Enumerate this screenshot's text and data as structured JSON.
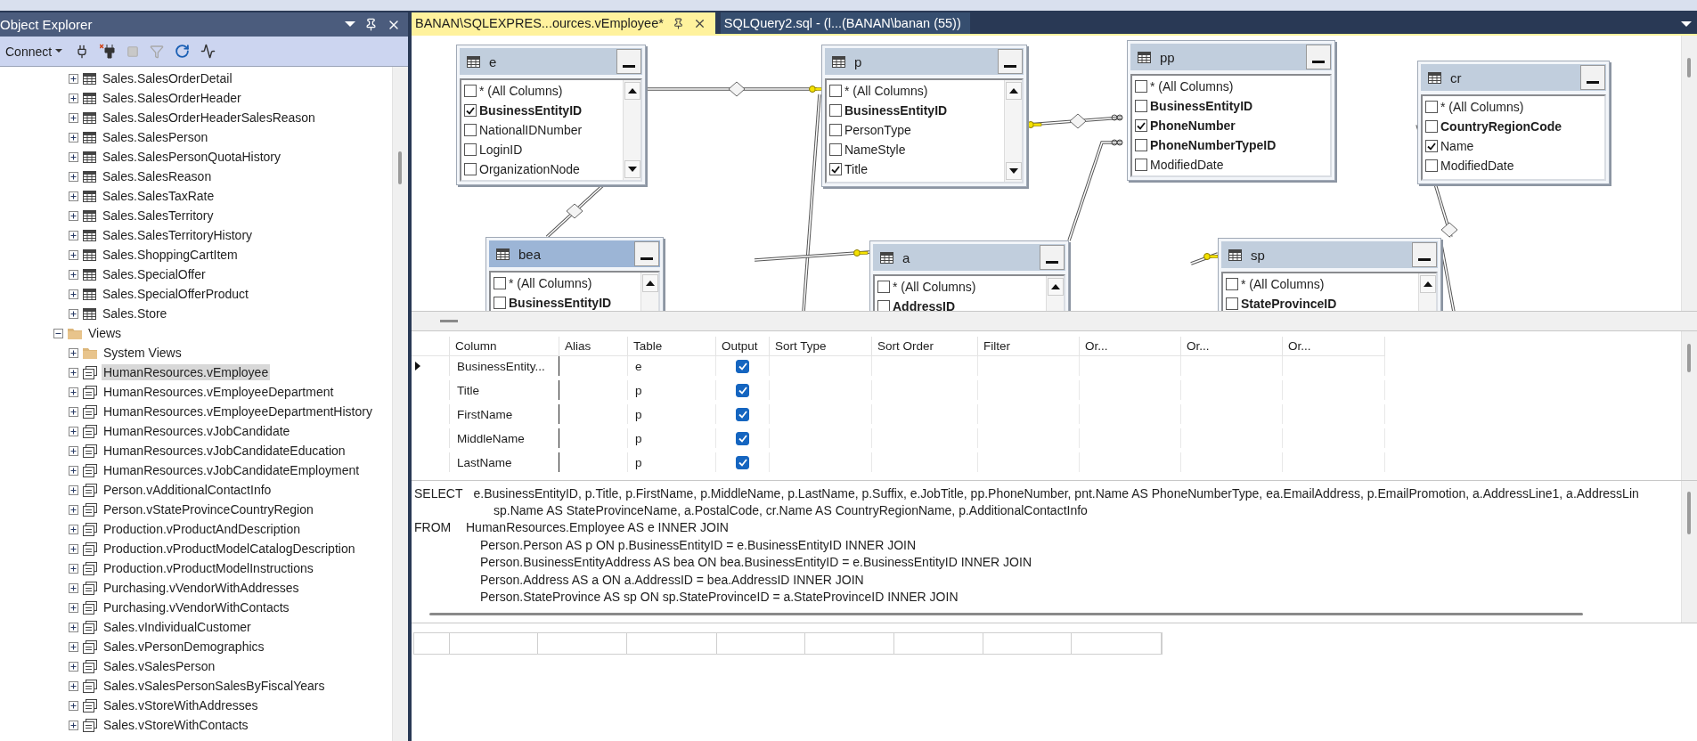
{
  "object_explorer": {
    "title": "Object Explorer",
    "toolbar": {
      "connect": "Connect"
    },
    "tree": [
      {
        "kind": "group",
        "children": [
          {
            "label": "Sales.SalesOrderDetail",
            "kind": "table",
            "expanded": false,
            "selected": false
          },
          {
            "label": "Sales.SalesOrderHeader",
            "kind": "table",
            "expanded": false,
            "selected": false
          },
          {
            "label": "Sales.SalesOrderHeaderSalesReason",
            "kind": "table",
            "expanded": false,
            "selected": false
          },
          {
            "label": "Sales.SalesPerson",
            "kind": "table",
            "expanded": false,
            "selected": false
          },
          {
            "label": "Sales.SalesPersonQuotaHistory",
            "kind": "table",
            "expanded": false,
            "selected": false
          },
          {
            "label": "Sales.SalesReason",
            "kind": "table",
            "expanded": false,
            "selected": false
          },
          {
            "label": "Sales.SalesTaxRate",
            "kind": "table",
            "expanded": false,
            "selected": false
          },
          {
            "label": "Sales.SalesTerritory",
            "kind": "table",
            "expanded": false,
            "selected": false
          },
          {
            "label": "Sales.SalesTerritoryHistory",
            "kind": "table",
            "expanded": false,
            "selected": false
          },
          {
            "label": "Sales.ShoppingCartItem",
            "kind": "table",
            "expanded": false,
            "selected": false
          },
          {
            "label": "Sales.SpecialOffer",
            "kind": "table",
            "expanded": false,
            "selected": false
          },
          {
            "label": "Sales.SpecialOfferProduct",
            "kind": "table",
            "expanded": false,
            "selected": false
          },
          {
            "label": "Sales.Store",
            "kind": "table",
            "expanded": false,
            "selected": false
          }
        ]
      },
      {
        "label": "Views",
        "kind": "folder",
        "expanded": true,
        "selected": false,
        "children": [
          {
            "label": "System Views",
            "kind": "folder",
            "expanded": false,
            "selected": false
          },
          {
            "label": "HumanResources.vEmployee",
            "kind": "view",
            "expanded": false,
            "selected": true
          },
          {
            "label": "HumanResources.vEmployeeDepartment",
            "kind": "view",
            "expanded": false,
            "selected": false
          },
          {
            "label": "HumanResources.vEmployeeDepartmentHistory",
            "kind": "view",
            "expanded": false,
            "selected": false
          },
          {
            "label": "HumanResources.vJobCandidate",
            "kind": "view",
            "expanded": false,
            "selected": false
          },
          {
            "label": "HumanResources.vJobCandidateEducation",
            "kind": "view",
            "expanded": false,
            "selected": false
          },
          {
            "label": "HumanResources.vJobCandidateEmployment",
            "kind": "view",
            "expanded": false,
            "selected": false
          },
          {
            "label": "Person.vAdditionalContactInfo",
            "kind": "view",
            "expanded": false,
            "selected": false
          },
          {
            "label": "Person.vStateProvinceCountryRegion",
            "kind": "view",
            "expanded": false,
            "selected": false
          },
          {
            "label": "Production.vProductAndDescription",
            "kind": "view",
            "expanded": false,
            "selected": false
          },
          {
            "label": "Production.vProductModelCatalogDescription",
            "kind": "view",
            "expanded": false,
            "selected": false
          },
          {
            "label": "Production.vProductModelInstructions",
            "kind": "view",
            "expanded": false,
            "selected": false
          },
          {
            "label": "Purchasing.vVendorWithAddresses",
            "kind": "view",
            "expanded": false,
            "selected": false
          },
          {
            "label": "Purchasing.vVendorWithContacts",
            "kind": "view",
            "expanded": false,
            "selected": false
          },
          {
            "label": "Sales.vIndividualCustomer",
            "kind": "view",
            "expanded": false,
            "selected": false
          },
          {
            "label": "Sales.vPersonDemographics",
            "kind": "view",
            "expanded": false,
            "selected": false
          },
          {
            "label": "Sales.vSalesPerson",
            "kind": "view",
            "expanded": false,
            "selected": false
          },
          {
            "label": "Sales.vSalesPersonSalesByFiscalYears",
            "kind": "view",
            "expanded": false,
            "selected": false
          },
          {
            "label": "Sales.vStoreWithAddresses",
            "kind": "view",
            "expanded": false,
            "selected": false
          },
          {
            "label": "Sales.vStoreWithContacts",
            "kind": "view",
            "expanded": false,
            "selected": false
          }
        ]
      }
    ]
  },
  "tabs": [
    {
      "label": "BANAN\\SQLEXPRES...ources.vEmployee*",
      "selected": true
    },
    {
      "label": "SQLQuery2.sql - (l...(BANAN\\banan (55))",
      "selected": false
    }
  ],
  "diagram": {
    "tables": [
      {
        "alias": "e",
        "selected": false,
        "scrollable": true,
        "columns": [
          {
            "name": "* (All Columns)",
            "key": false,
            "checked": false
          },
          {
            "name": "BusinessEntityID",
            "key": true,
            "checked": true
          },
          {
            "name": "NationalIDNumber",
            "key": false,
            "checked": false
          },
          {
            "name": "LoginID",
            "key": false,
            "checked": false
          },
          {
            "name": "OrganizationNode",
            "key": false,
            "checked": false
          }
        ]
      },
      {
        "alias": "p",
        "selected": false,
        "scrollable": true,
        "columns": [
          {
            "name": "* (All Columns)",
            "key": false,
            "checked": false
          },
          {
            "name": "BusinessEntityID",
            "key": true,
            "checked": false
          },
          {
            "name": "PersonType",
            "key": false,
            "checked": false
          },
          {
            "name": "NameStyle",
            "key": false,
            "checked": false
          },
          {
            "name": "Title",
            "key": false,
            "checked": true
          }
        ]
      },
      {
        "alias": "pp",
        "selected": false,
        "scrollable": false,
        "columns": [
          {
            "name": "* (All Columns)",
            "key": false,
            "checked": false
          },
          {
            "name": "BusinessEntityID",
            "key": true,
            "checked": false
          },
          {
            "name": "PhoneNumber",
            "key": true,
            "checked": true
          },
          {
            "name": "PhoneNumberTypeID",
            "key": true,
            "checked": false
          },
          {
            "name": "ModifiedDate",
            "key": false,
            "checked": false
          }
        ]
      },
      {
        "alias": "cr",
        "selected": false,
        "scrollable": false,
        "columns": [
          {
            "name": "* (All Columns)",
            "key": false,
            "checked": false
          },
          {
            "name": "CountryRegionCode",
            "key": true,
            "checked": false
          },
          {
            "name": "Name",
            "key": false,
            "checked": true
          },
          {
            "name": "ModifiedDate",
            "key": false,
            "checked": false
          }
        ]
      },
      {
        "alias": "bea",
        "selected": true,
        "scrollable": true,
        "columns": [
          {
            "name": "* (All Columns)",
            "key": false,
            "checked": false
          },
          {
            "name": "BusinessEntityID",
            "key": true,
            "checked": false
          }
        ]
      },
      {
        "alias": "a",
        "selected": false,
        "scrollable": true,
        "columns": [
          {
            "name": "* (All Columns)",
            "key": false,
            "checked": false
          },
          {
            "name": "AddressID",
            "key": true,
            "checked": false
          }
        ]
      },
      {
        "alias": "sp",
        "selected": false,
        "scrollable": true,
        "columns": [
          {
            "name": "* (All Columns)",
            "key": false,
            "checked": false
          },
          {
            "name": "StateProvinceID",
            "key": true,
            "checked": false
          }
        ]
      }
    ]
  },
  "criteria_grid": {
    "headers": [
      "Column",
      "Alias",
      "Table",
      "Output",
      "Sort Type",
      "Sort Order",
      "Filter",
      "Or...",
      "Or...",
      "Or..."
    ],
    "rows": [
      {
        "column": "BusinessEntity...",
        "table": "e",
        "output": true,
        "current": true
      },
      {
        "column": "Title",
        "table": "p",
        "output": true,
        "current": false
      },
      {
        "column": "FirstName",
        "table": "p",
        "output": true,
        "current": false
      },
      {
        "column": "MiddleName",
        "table": "p",
        "output": true,
        "current": false
      },
      {
        "column": "LastName",
        "table": "p",
        "output": true,
        "current": false
      }
    ]
  },
  "sql": [
    {
      "kind": "clause",
      "keyword": "SELECT",
      "text": "e.BusinessEntityID, p.Title, p.FirstName, p.MiddleName, p.LastName, p.Suffix, e.JobTitle, pp.PhoneNumber, pnt.Name AS PhoneNumberType, ea.EmailAddress, p.EmailPromotion, a.AddressLine1, a.AddressLin"
    },
    {
      "kind": "select_list",
      "text": "sp.Name AS StateProvinceName, a.PostalCode, cr.Name AS CountryRegionName, p.AdditionalContactInfo"
    },
    {
      "kind": "clause",
      "keyword": "FROM",
      "text": "HumanResources.Employee AS e INNER JOIN"
    },
    {
      "kind": "join",
      "text": "Person.Person AS p ON p.BusinessEntityID = e.BusinessEntityID INNER JOIN"
    },
    {
      "kind": "join",
      "text": "Person.BusinessEntityAddress AS bea ON bea.BusinessEntityID = e.BusinessEntityID INNER JOIN"
    },
    {
      "kind": "join",
      "text": "Person.Address AS a ON a.AddressID = bea.AddressID INNER JOIN"
    },
    {
      "kind": "join",
      "text": "Person.StateProvince AS sp ON sp.StateProvinceID = a.StateProvinceID INNER JOIN"
    }
  ]
}
